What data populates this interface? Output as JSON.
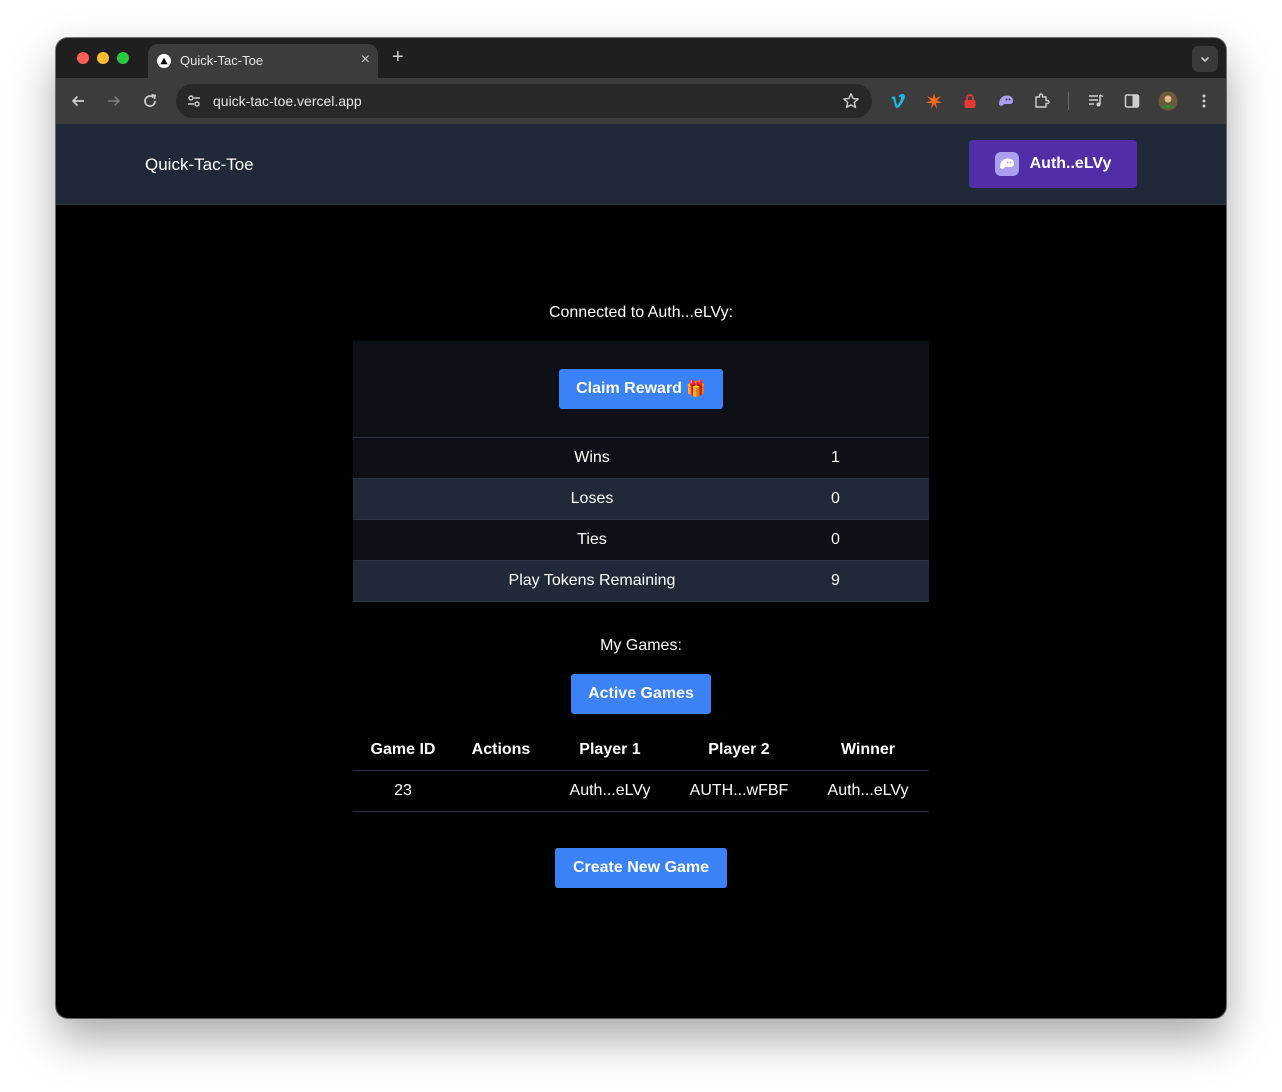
{
  "browser": {
    "tab_title": "Quick-Tac-Toe",
    "url": "quick-tac-toe.vercel.app"
  },
  "header": {
    "brand": "Quick-Tac-Toe",
    "wallet_label": "Auth..eLVy"
  },
  "main": {
    "connected_text": "Connected to Auth...eLVy:",
    "claim_label": "Claim Reward",
    "claim_emoji": "🎁",
    "stats": [
      {
        "label": "Wins",
        "value": "1"
      },
      {
        "label": "Loses",
        "value": "0"
      },
      {
        "label": "Ties",
        "value": "0"
      },
      {
        "label": "Play Tokens Remaining",
        "value": "9"
      }
    ],
    "my_games_label": "My Games:",
    "active_games_label": "Active Games",
    "games_table": {
      "headers": [
        "Game ID",
        "Actions",
        "Player 1",
        "Player 2",
        "Winner"
      ],
      "rows": [
        {
          "game_id": "23",
          "actions": "",
          "player1": "Auth...eLVy",
          "player2": "AUTH...wFBF",
          "winner": "Auth...eLVy"
        }
      ]
    },
    "create_game_label": "Create New Game"
  },
  "colors": {
    "header_bg": "#1f2937",
    "wallet_button": "#512da8",
    "primary_button": "#3b82f6",
    "page_bg": "#000000"
  }
}
